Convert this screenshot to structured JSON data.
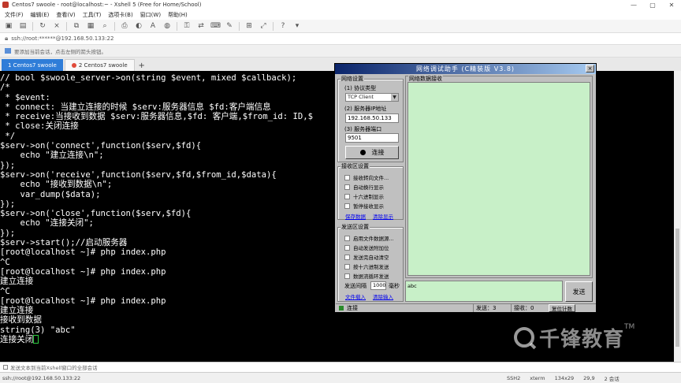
{
  "window": {
    "title": "Centos7 swoole - root@localhost:~ - Xshell 5 (Free for Home/School)",
    "controls": [
      "—",
      "▢",
      "✕"
    ]
  },
  "menu": [
    "文件(F)",
    "编辑(E)",
    "查看(V)",
    "工具(T)",
    "选项卡(B)",
    "窗口(W)",
    "帮助(H)"
  ],
  "address": "ssh://root:******@192.168.50.133:22",
  "hint": "要添加当前会话，点击左侧的箭头按钮。",
  "tabs": [
    {
      "label": "1 Centos7 swoole",
      "active": true
    },
    {
      "label": "2 Centos7 swoole",
      "active": false
    }
  ],
  "terminal_lines": [
    "// bool $swoole_server->on(string $event, mixed $callback);",
    "/*",
    " * $event:",
    " * connect: 当建立连接的时候 $serv:服务器信息 $fd:客户端信息",
    " * receive:当接收到数据 $serv:服务器信息,$fd: 客户端,$from_id: ID,$",
    " * close:关闭连接",
    " */",
    "$serv->on('connect',function($serv,$fd){",
    "    echo \"建立连接\\n\";",
    "});",
    "$serv->on('receive',function($serv,$fd,$from_id,$data){",
    "    echo \"接收到数据\\n\";",
    "    var_dump($data);",
    "});",
    "$serv->on('close',function($serv,$fd){",
    "    echo \"连接关闭\";",
    "});",
    "",
    "$serv->start();//启动服务器",
    "[root@localhost ~]# php index.php",
    "^C",
    "[root@localhost ~]# php index.php",
    "建立连接",
    "^C",
    "[root@localhost ~]# php index.php",
    "建立连接",
    "接收到数据",
    "string(3) \"abc\"",
    "连接关闭"
  ],
  "send_bar": "发送文本到当前Xshell窗口的全部会话",
  "status": {
    "connection": "ssh://root@192.168.50.133:22",
    "protocol": "SSH2",
    "term": "xterm",
    "size": "134x29",
    "pos": "29,9",
    "sessions": "2 会话"
  },
  "nettool": {
    "title": "网络调试助手 (C精装版 V3.8)",
    "close": "×",
    "net_settings": "网络设置",
    "protocol_label": "(1) 协议类型",
    "protocol_value": "TCP Client",
    "ip_label": "(2) 服务器IP地址",
    "ip_value": "192.168.50.133",
    "port_label": "(3) 服务器端口",
    "port_value": "9501",
    "connect_button": "连接",
    "recv_settings": "接收区设置",
    "recv_options": [
      "接收转向文件...",
      "自动换行显示",
      "十六进制显示",
      "暂停接收显示"
    ],
    "save_data": "保存数据",
    "clear_display": "清除显示",
    "send_settings": "发送区设置",
    "send_options": [
      "启用文件数据源...",
      "自动发送附加位",
      "发送完自动清空",
      "按十六进制发送",
      "数据流循环发送"
    ],
    "interval_label": "发送间隔",
    "interval_value": "1000",
    "interval_unit": "毫秒",
    "file_load": "文件载入",
    "clear_input": "清除输入",
    "recv_area_title": "网络数据接收",
    "send_text": "abc",
    "send_button": "发送",
    "status_conn": "连接",
    "sent_label": "发送：3",
    "recv_label": "接收：0",
    "reset_count": "复位计数"
  },
  "watermark": {
    "text": "千锋教育",
    "tm": "TM"
  }
}
